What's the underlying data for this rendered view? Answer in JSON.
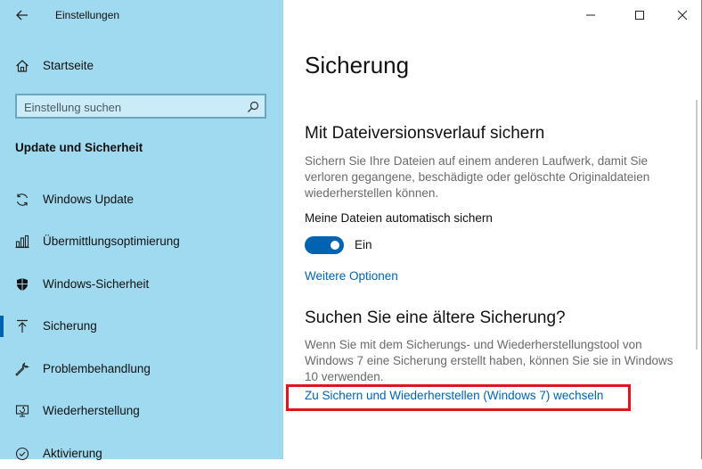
{
  "window": {
    "app_title": "Einstellungen",
    "controls": {
      "minimize": "minimize-icon",
      "maximize": "maximize-icon",
      "close": "close-icon"
    }
  },
  "sidebar": {
    "home_label": "Startseite",
    "search": {
      "placeholder": "Einstellung suchen"
    },
    "section_heading": "Update und Sicherheit",
    "items": [
      {
        "label": "Windows Update",
        "icon": "sync-icon"
      },
      {
        "label": "Übermittlungsoptimierung",
        "icon": "delivery-optimization-icon"
      },
      {
        "label": "Windows-Sicherheit",
        "icon": "shield-icon"
      },
      {
        "label": "Sicherung",
        "icon": "backup-arrow-icon",
        "active": true
      },
      {
        "label": "Problembehandlung",
        "icon": "wrench-icon"
      },
      {
        "label": "Wiederherstellung",
        "icon": "recovery-icon"
      },
      {
        "label": "Aktivierung",
        "icon": "check-circle-icon"
      }
    ]
  },
  "main": {
    "page_title": "Sicherung",
    "file_history": {
      "heading": "Mit Dateiversionsverlauf sichern",
      "description": "Sichern Sie Ihre Dateien auf einem anderen Laufwerk, damit Sie verloren gegangene, beschädigte oder gelöschte Originaldateien wiederherstellen können.",
      "auto_backup_label": "Meine Dateien automatisch sichern",
      "toggle_state": "Ein",
      "more_options_link": "Weitere Optionen"
    },
    "older_backup": {
      "heading": "Suchen Sie eine ältere Sicherung?",
      "description": "Wenn Sie mit dem Sicherungs- und Wiederherstellungstool von Windows 7 eine Sicherung erstellt haben, können Sie sie in Windows 10 verwenden.",
      "switch_link": "Zu Sichern und Wiederherstellen (Windows 7) wechseln"
    }
  },
  "colors": {
    "sidebar_bg": "#9fdaf0",
    "accent": "#0063b1",
    "highlight_box": "#e1141e"
  }
}
